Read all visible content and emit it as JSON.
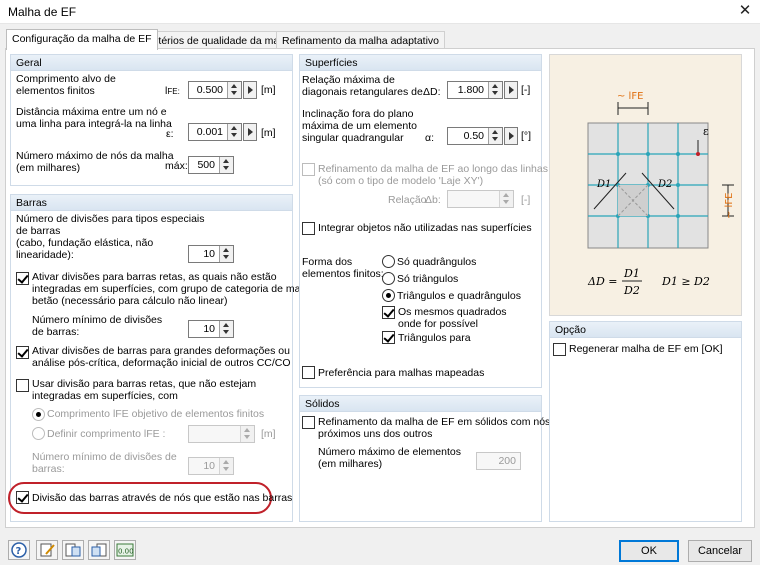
{
  "window": {
    "title": "Malha de EF",
    "close": "✕"
  },
  "tabs": [
    "Configuração da malha de EF",
    "Critérios de qualidade da malha",
    "Refinamento da malha adaptativo"
  ],
  "geral": {
    "header": "Geral",
    "target_len_label1": "Comprimento alvo de",
    "target_len_label2": "elementos finitos",
    "target_len_sym": "l",
    "target_len_sub": "FE:",
    "target_len_value": "0.500",
    "target_len_unit": "[m]",
    "max_dist_label1": "Distância máxima entre um nó e",
    "max_dist_label2": "uma linha para integrá-la na linha",
    "max_dist_sym": "ε:",
    "max_dist_value": "0.001",
    "max_dist_unit": "[m]",
    "max_nodes_label1": "Número máximo de nós da malha",
    "max_nodes_label2": "(em milhares)",
    "max_nodes_sym": "máx:",
    "max_nodes_value": "500"
  },
  "barras": {
    "header": "Barras",
    "div_special_1": "Número de divisões para tipos especiais",
    "div_special_2": "de barras",
    "div_special_3": "(cabo, fundação elástica, não",
    "div_special_4": "linearidade):",
    "div_special_value": "10",
    "activate_straight_1": "Ativar divisões para barras retas, as quais não estão",
    "activate_straight_2": "integradas em superfícies, com grupo de categoria de material",
    "activate_straight_3": "betão (necessário para cálculo não linear)",
    "min_div_1": "Número mínimo de divisões",
    "min_div_2": "de barras:",
    "min_div_value": "10",
    "large_def_1": "Ativar divisões de barras para grandes deformações ou",
    "large_def_2": "análise pós-crítica, deformação inicial de outros CC/CO",
    "use_div_1": "Usar divisão para barras retas, que não estejam",
    "use_div_2": "integradas em superfícies, com",
    "radio_target": "Comprimento lFE objetivo de elementos finitos",
    "radio_define": "Definir comprimento lFE :",
    "define_unit": "[m]",
    "min_div2_1": "Número mínimo de divisões de",
    "min_div2_2": "barras:",
    "min_div2_value": "10",
    "nodes_div": "Divisão das barras através de nós que estão nas barras"
  },
  "superficies": {
    "header": "Superfícies",
    "ratio_1": "Relação máxima de",
    "ratio_2": "diagonais retangulares de",
    "ratio_sym": "ΔD:",
    "ratio_value": "1.800",
    "ratio_unit": "[-]",
    "incl_1": "Inclinação fora do plano",
    "incl_2": "máxima de um elemento",
    "incl_3": "singular quadrangular",
    "incl_sym": "α:",
    "incl_value": "0.50",
    "incl_unit": "[°]",
    "refine_lines_1": "Refinamento da malha de EF ao longo das linhas",
    "refine_lines_2": "(só com o tipo de modelo 'Laje XY')",
    "relation_label": "Relação",
    "relation_sym": "Δb:",
    "relation_unit": "[-]",
    "integrate": "Integrar objetos não utilizadas nas superfícies",
    "shape_1": "Forma dos",
    "shape_2": "elementos finitos:",
    "opt_quads": "Só quadrângulos",
    "opt_tris": "Só triângulos",
    "opt_both": "Triângulos e quadrângulos",
    "same_squares_1": "Os mesmos quadrados",
    "same_squares_2": "onde for possível",
    "tris_for": "Triângulos para",
    "mapped": "Preferência para malhas mapeadas"
  },
  "solidos": {
    "header": "Sólidos",
    "refine_1": "Refinamento da malha de EF em sólidos com nós",
    "refine_2": "próximos uns dos outros",
    "max_el_1": "Número máximo de elementos",
    "max_el_2": "(em milhares)",
    "max_el_value": "200"
  },
  "diagram": {
    "l_fe": "~ lFE",
    "eps": "ε",
    "d1": "D1",
    "d2": "D2",
    "side_lfe": "~ lFE",
    "formula_lhs": "ΔD =",
    "formula_num": "D1",
    "formula_den": "D2",
    "formula_cond": "D1 ≥ D2",
    "colors": {
      "grid": "#2aa5b8",
      "plate": "#e2e2e2",
      "bg": "#f7f0e3",
      "node": "#c0212a"
    }
  },
  "opcao": {
    "header": "Opção",
    "regen": "Regenerar malha de EF em [OK]"
  },
  "footer": {
    "ok": "OK",
    "cancel": "Cancelar",
    "tool_icons": [
      "help-icon",
      "edit-icon",
      "import-icon",
      "export-icon",
      "units-icon"
    ],
    "units_glyph": "0.00"
  }
}
